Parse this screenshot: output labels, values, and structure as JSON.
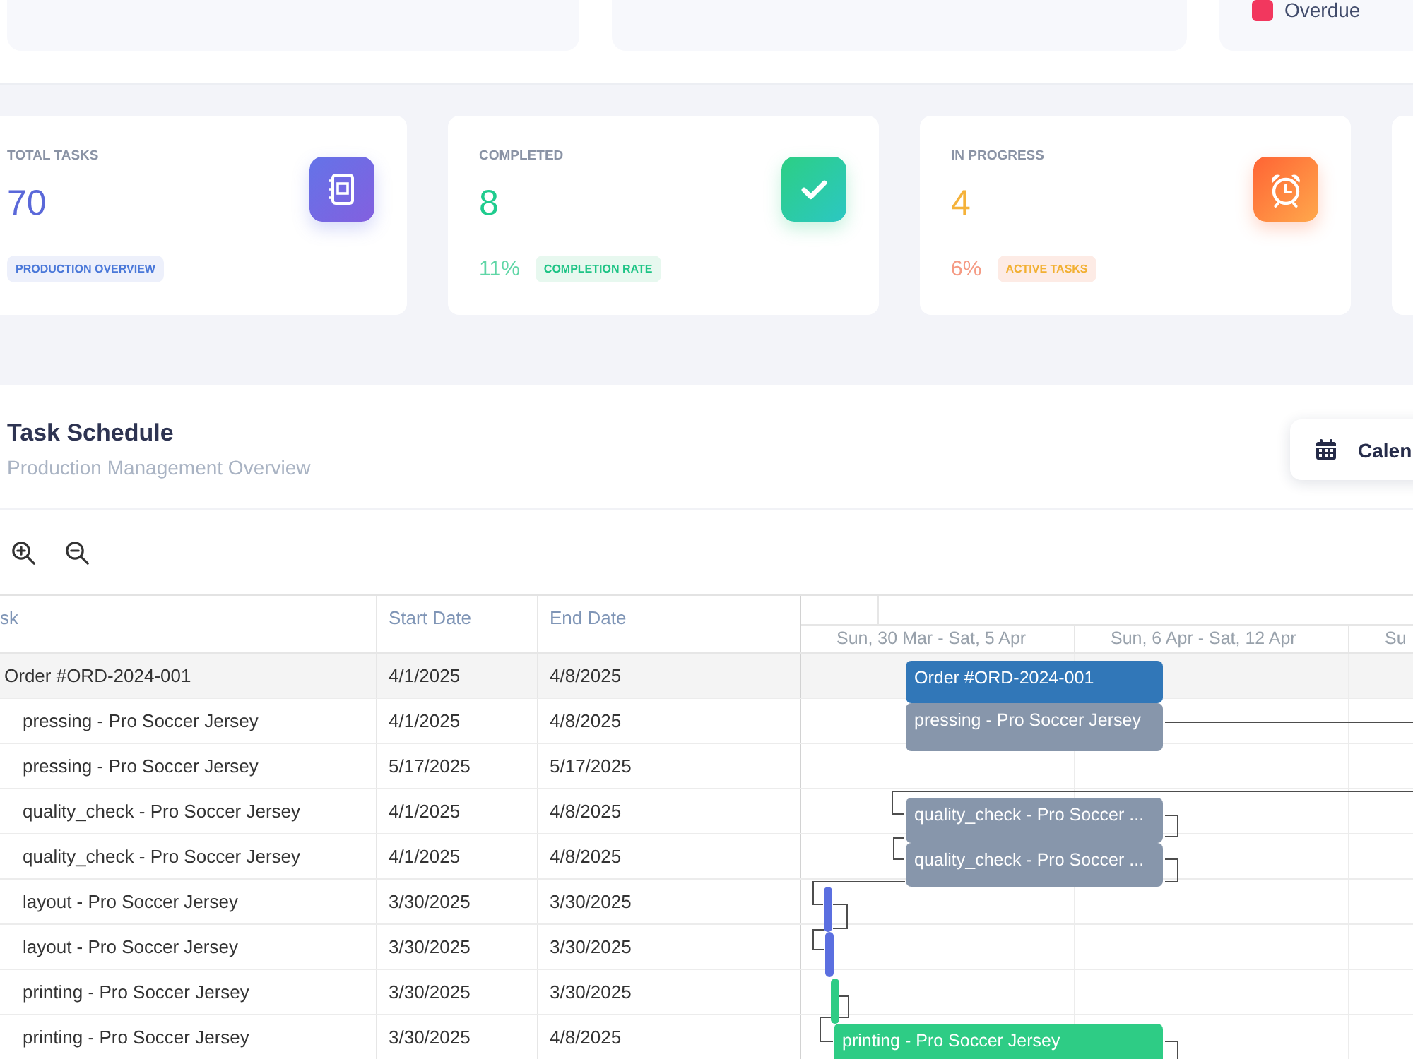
{
  "status_legend": [
    {
      "label": "Overdue",
      "color": "#f2375e"
    }
  ],
  "stats": [
    {
      "label": "TOTAL TASKS",
      "value": "70",
      "color": "#5a68d9",
      "badge": "PRODUCTION OVERVIEW"
    },
    {
      "label": "COMPLETED",
      "value": "8",
      "color": "#1fcc8e",
      "percent": "11%",
      "badge": "COMPLETION RATE"
    },
    {
      "label": "IN PROGRESS",
      "value": "4",
      "color": "#f5b23a",
      "percent": "6%",
      "badge": "ACTIVE TASKS"
    }
  ],
  "schedule": {
    "title": "Task Schedule",
    "subtitle": "Production Management Overview",
    "calendar_button": "Calen"
  },
  "table": {
    "columns": [
      "sk",
      "Start Date",
      "End Date"
    ],
    "rows": [
      {
        "task": "Order #ORD-2024-001",
        "start": "4/1/2025",
        "end": "4/8/2025",
        "children": [
          {
            "task": "pressing - Pro Soccer Jersey",
            "start": "4/1/2025",
            "end": "4/8/2025"
          },
          {
            "task": "pressing - Pro Soccer Jersey",
            "start": "5/17/2025",
            "end": "5/17/2025"
          },
          {
            "task": "quality_check - Pro Soccer Jersey",
            "start": "4/1/2025",
            "end": "4/8/2025"
          },
          {
            "task": "quality_check - Pro Soccer Jersey",
            "start": "4/1/2025",
            "end": "4/8/2025"
          },
          {
            "task": "layout - Pro Soccer Jersey",
            "start": "3/30/2025",
            "end": "3/30/2025"
          },
          {
            "task": "layout - Pro Soccer Jersey",
            "start": "3/30/2025",
            "end": "3/30/2025"
          },
          {
            "task": "printing - Pro Soccer Jersey",
            "start": "3/30/2025",
            "end": "3/30/2025"
          },
          {
            "task": "printing - Pro Soccer Jersey",
            "start": "3/30/2025",
            "end": "4/8/2025"
          }
        ]
      }
    ]
  },
  "gantt": {
    "weeks": [
      "Sun, 30 Mar - Sat, 5 Apr",
      "Sun, 6 Apr - Sat, 12 Apr",
      "Su"
    ],
    "bars": [
      {
        "label": "Order #ORD-2024-001",
        "color": "#3177b8"
      },
      {
        "label": "pressing - Pro Soccer Jersey",
        "color": "#8796ab"
      },
      {
        "label": "quality_check - Pro Soccer ...",
        "color": "#8796ab"
      },
      {
        "label": "quality_check - Pro Soccer ...",
        "color": "#8796ab"
      },
      {
        "color": "#5b6fe0"
      },
      {
        "color": "#5b6fe0"
      },
      {
        "color": "#2ecc85"
      },
      {
        "label": "printing - Pro Soccer Jersey",
        "color": "#2ecc85"
      }
    ]
  }
}
